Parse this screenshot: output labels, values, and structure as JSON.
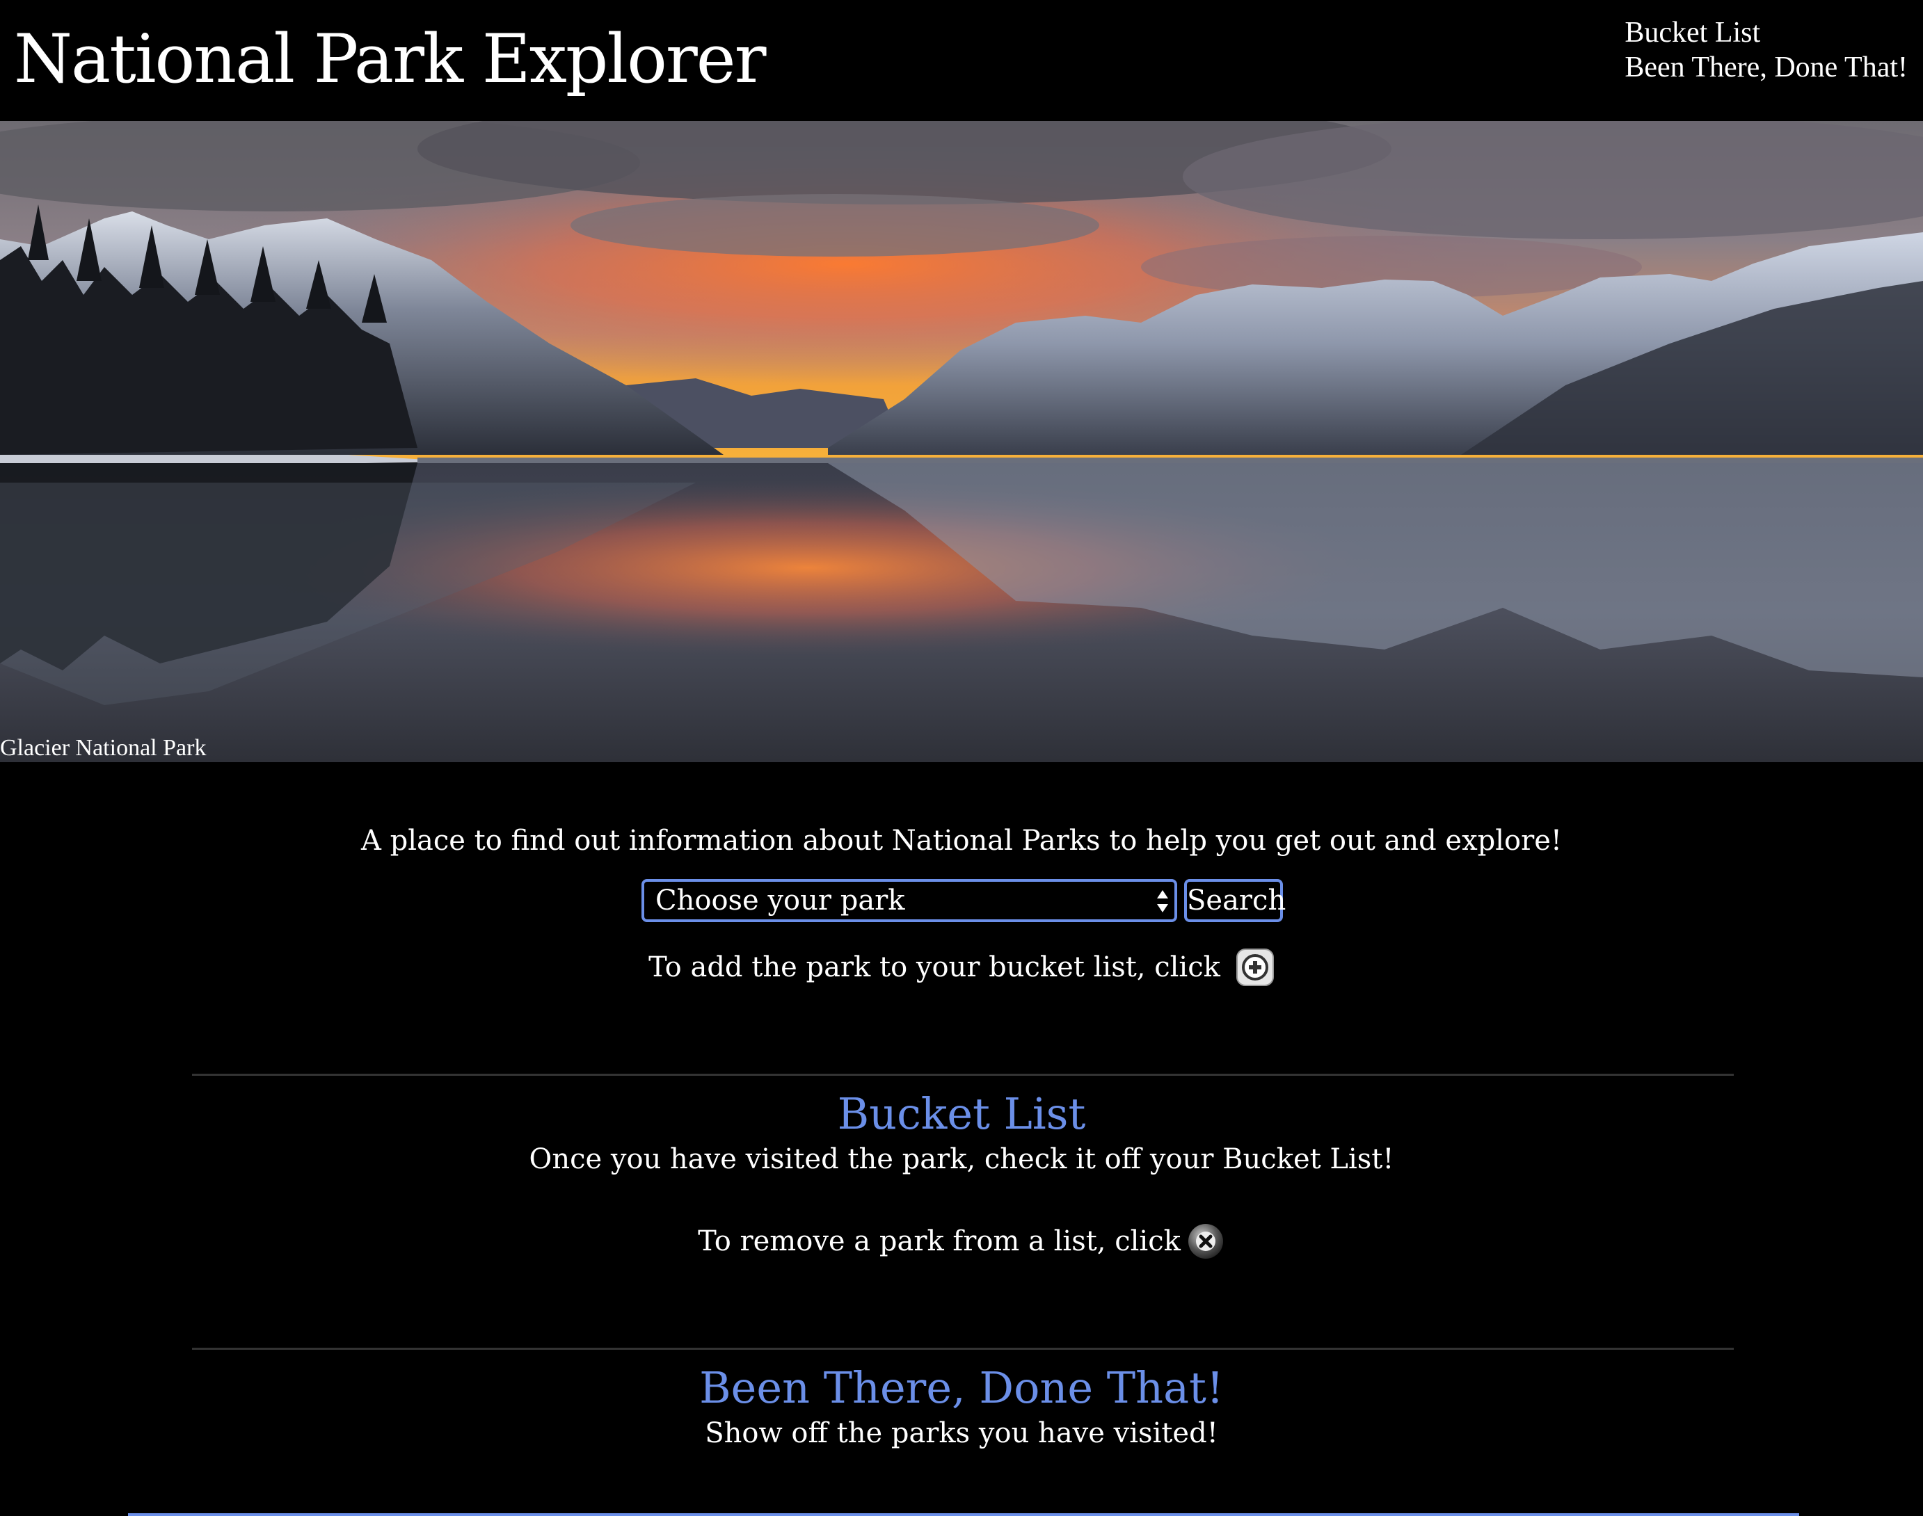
{
  "header": {
    "title": "National Park Explorer",
    "nav": [
      {
        "label": "Bucket List"
      },
      {
        "label": "Been There, Done That!"
      }
    ]
  },
  "hero": {
    "caption": "Glacier National Park"
  },
  "main": {
    "tagline": "A place to find out information about National Parks to help you get out and explore!",
    "select": {
      "selected": "Choose your park"
    },
    "search_label": "Search",
    "add_hint": "To add the park to your bucket list, click"
  },
  "bucket_list": {
    "heading": "Bucket List",
    "subtext": "Once you have visited the park, check it off your Bucket List!",
    "remove_hint": "To remove a park from a list, click"
  },
  "been_there": {
    "heading": "Been There, Done That!",
    "subtext": "Show off the parks you have visited!"
  },
  "colors": {
    "accent": "#6b8fe8",
    "background": "#000000"
  },
  "icons": {
    "add": "plus-circle-icon",
    "remove": "x-circle-icon",
    "select": "sort-arrows-icon"
  }
}
